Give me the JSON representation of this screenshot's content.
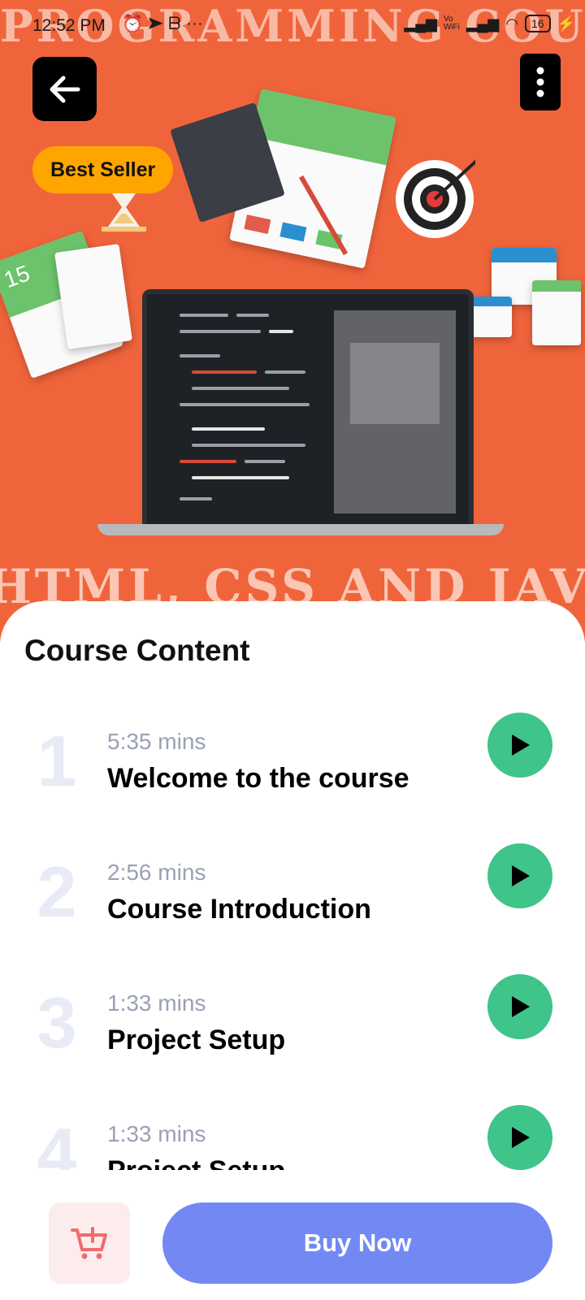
{
  "status_bar": {
    "time": "12:52 PM",
    "left_icons": [
      "alarm-icon",
      "telegram-icon",
      "app-icon",
      "more-icon"
    ],
    "battery": "16"
  },
  "hero": {
    "banner_top": "PROGRAMMING COURSE",
    "banner_bottom": "HTML, CSS AND JAVA",
    "badge": "Best Seller",
    "background_color": "#f0643c"
  },
  "course_content": {
    "title": "Course Content",
    "lessons": [
      {
        "number": "1",
        "duration": "5:35 mins",
        "title": "Welcome to the course"
      },
      {
        "number": "2",
        "duration": "2:56 mins",
        "title": "Course Introduction"
      },
      {
        "number": "3",
        "duration": "1:33 mins",
        "title": "Project Setup"
      },
      {
        "number": "4",
        "duration": "1:33 mins",
        "title": "Project Setup"
      }
    ]
  },
  "actions": {
    "buy_label": "Buy Now",
    "buy_color": "#7289f4",
    "play_color": "#3fc48a"
  }
}
